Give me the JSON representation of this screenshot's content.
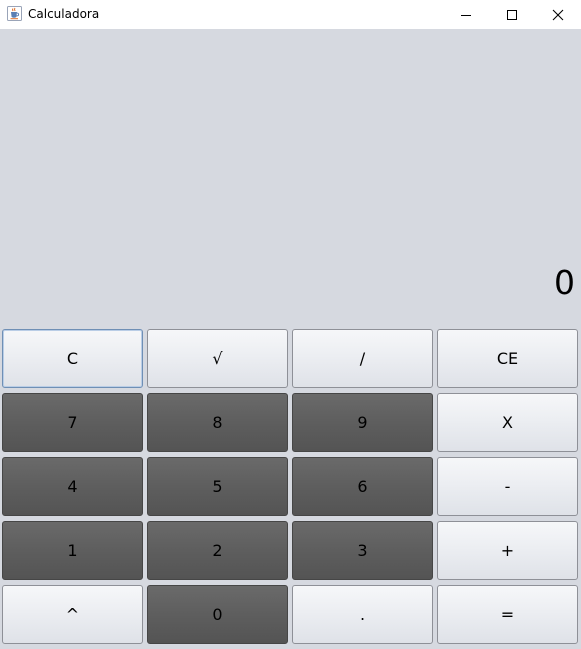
{
  "window": {
    "title": "Calculadora"
  },
  "display": {
    "value": "0"
  },
  "keys": {
    "clear": "C",
    "sqrt": "√",
    "divide": "/",
    "clear_entry": "CE",
    "seven": "7",
    "eight": "8",
    "nine": "9",
    "multiply": "X",
    "four": "4",
    "five": "5",
    "six": "6",
    "subtract": "-",
    "one": "1",
    "two": "2",
    "three": "3",
    "add": "+",
    "power": "^",
    "zero": "0",
    "decimal": ".",
    "equals": "="
  },
  "colors": {
    "background": "#d6d9e0",
    "digit_key": "#5e5e5e",
    "operator_key": "#eceef2",
    "focus_border": "#6f8fb5"
  },
  "icons": {
    "app": "java-cup-icon",
    "minimize": "minimize-icon",
    "maximize": "maximize-icon",
    "close": "close-icon"
  }
}
